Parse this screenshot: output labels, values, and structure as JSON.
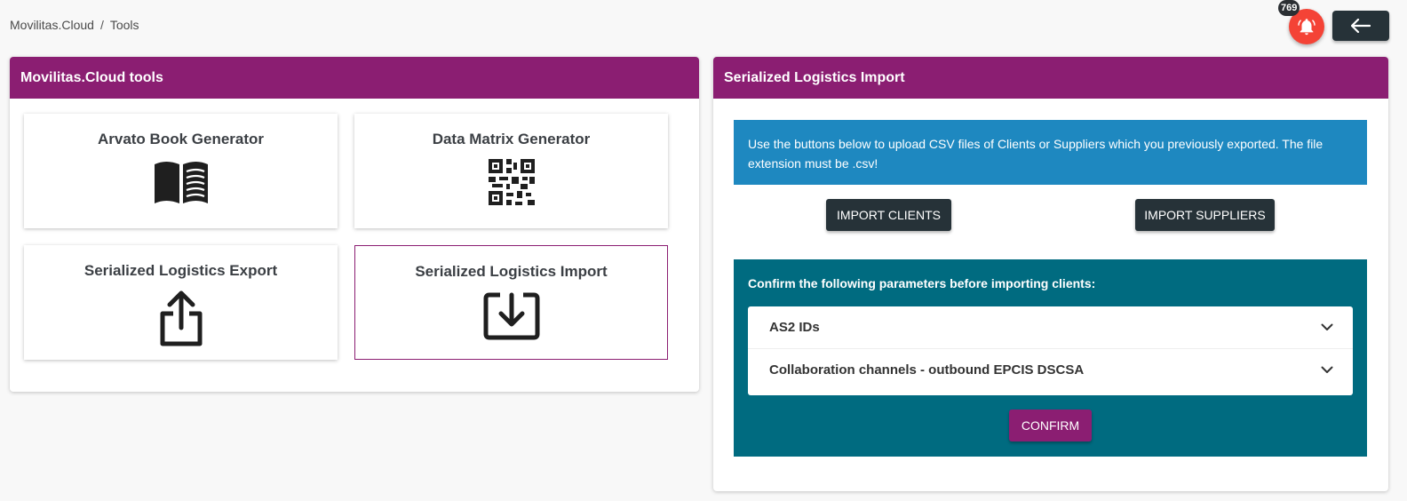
{
  "breadcrumb": {
    "root": "Movilitas.Cloud",
    "separator": "/",
    "current": "Tools"
  },
  "header": {
    "notification_count": "769",
    "bell_icon": "bell-icon",
    "back_icon": "arrow-left-icon"
  },
  "tools_panel": {
    "title": "Movilitas.Cloud tools",
    "tiles": [
      {
        "label": "Arvato Book Generator",
        "icon": "book-icon"
      },
      {
        "label": "Data Matrix Generator",
        "icon": "qr-code-icon"
      },
      {
        "label": "Serialized Logistics Export",
        "icon": "upload-icon"
      },
      {
        "label": "Serialized Logistics Import",
        "icon": "download-icon"
      }
    ]
  },
  "import_panel": {
    "title": "Serialized Logistics Import",
    "info_text": "Use the buttons below to upload CSV files of Clients or Suppliers which you previously exported. The file extension must be .csv!",
    "import_clients_label": "IMPORT CLIENTS",
    "import_suppliers_label": "IMPORT SUPPLIERS",
    "confirm_title": "Confirm the following parameters before importing clients:",
    "params": [
      {
        "label": "AS2 IDs"
      },
      {
        "label": "Collaboration channels - outbound EPCIS DSCSA"
      }
    ],
    "confirm_label": "CONFIRM"
  },
  "colors": {
    "brand": "#8b1e72",
    "info": "#1e88c0",
    "teal": "#006b80",
    "dark_button": "#263238",
    "notification": "#f44336"
  }
}
